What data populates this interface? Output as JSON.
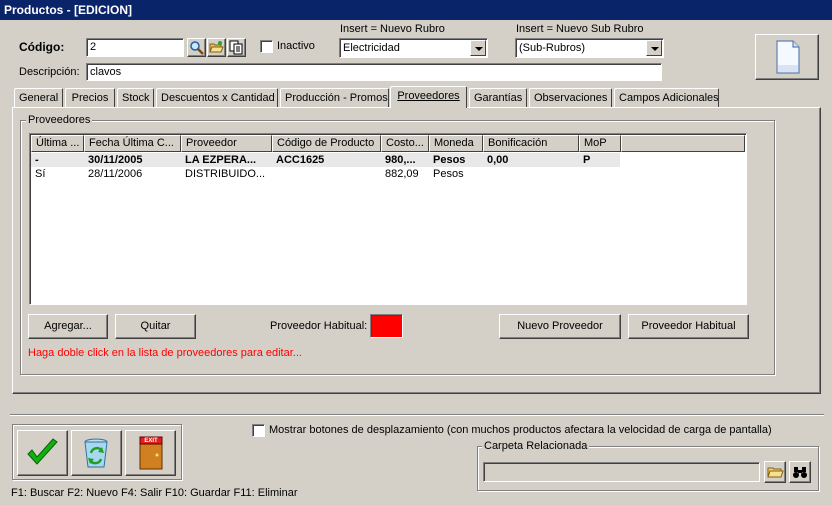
{
  "window": {
    "title": "Productos - [EDICION]"
  },
  "header": {
    "codigo_label": "Código:",
    "codigo_value": "2",
    "inactivo_label": "Inactivo",
    "rubro_caption": "Insert = Nuevo Rubro",
    "rubro_value": "Electricidad",
    "subrubro_caption": "Insert = Nuevo Sub Rubro",
    "subrubro_value": "(Sub-Rubros)",
    "descripcion_label": "Descripción:",
    "descripcion_value": "clavos"
  },
  "tabs": [
    {
      "label": "General"
    },
    {
      "label": "Precios"
    },
    {
      "label": "Stock"
    },
    {
      "label": "Descuentos x Cantidad"
    },
    {
      "label": "Producción - Promos"
    },
    {
      "label": "Proveedores"
    },
    {
      "label": "Garantías"
    },
    {
      "label": "Observaciones"
    },
    {
      "label": "Campos Adicionales"
    }
  ],
  "proveedores": {
    "group_title": "Proveedores",
    "columns": [
      "Última ...",
      "Fecha Última C...",
      "Proveedor",
      "Código de Producto",
      "Costo...",
      "Moneda",
      "Bonificación",
      "MoP"
    ],
    "rows": [
      [
        "-",
        "30/11/2005",
        "LA EZPERA...",
        "ACC1625",
        "980,...",
        "Pesos",
        "0,00",
        "P"
      ],
      [
        "Sí",
        "28/11/2006",
        "DISTRIBUIDO...",
        "",
        "882,09",
        "Pesos",
        "",
        ""
      ]
    ],
    "agregar_label": "Agregar...",
    "quitar_label": "Quitar",
    "habitual_label": "Proveedor Habitual:",
    "habitual_color": "#ff0000",
    "nuevo_proveedor_label": "Nuevo Proveedor",
    "proveedor_habitual_label": "Proveedor Habitual",
    "hint": "Haga doble click en la lista de proveedores para editar...",
    "hint_color": "#ff0000"
  },
  "footer": {
    "mostrar_label": "Mostrar botones de desplazamiento  (con muchos productos afectara la velocidad de carga de pantalla)",
    "carpeta_title": "Carpeta Relacionada",
    "carpeta_value": "",
    "exit_text": "EXIT",
    "shortcuts": "F1: Buscar  F2: Nuevo  F4: Salir  F10: Guardar  F11: Eliminar"
  }
}
